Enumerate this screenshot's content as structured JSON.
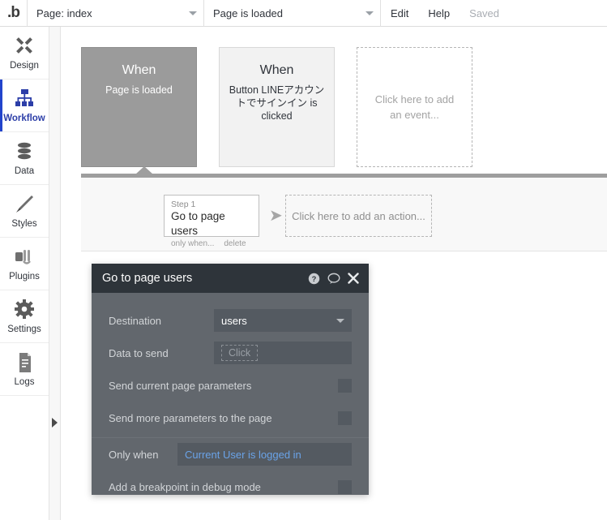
{
  "topbar": {
    "logo": ".b",
    "page_select": {
      "label": "Page: index",
      "icon": "chevron-down-icon"
    },
    "event_select": {
      "label": "Page is loaded",
      "icon": "chevron-down-icon"
    },
    "edit": "Edit",
    "help": "Help",
    "saved": "Saved"
  },
  "sidebar": {
    "items": [
      {
        "label": "Design",
        "icon": "design-icon",
        "active": false
      },
      {
        "label": "Workflow",
        "icon": "workflow-icon",
        "active": true
      },
      {
        "label": "Data",
        "icon": "data-icon",
        "active": false
      },
      {
        "label": "Styles",
        "icon": "styles-icon",
        "active": false
      },
      {
        "label": "Plugins",
        "icon": "plugins-icon",
        "active": false
      },
      {
        "label": "Settings",
        "icon": "gear-icon",
        "active": false
      },
      {
        "label": "Logs",
        "icon": "logs-icon",
        "active": false
      }
    ],
    "expander_icon": "right-triangle-icon"
  },
  "canvas": {
    "events": [
      {
        "when": "When",
        "desc": "Page is loaded",
        "state": "selected"
      },
      {
        "when": "When",
        "desc": "Button LINEアカウントでサインイン is clicked",
        "state": "plain"
      },
      {
        "add_label": "Click here to add an event...",
        "state": "add"
      }
    ],
    "actions": {
      "step": {
        "number": "Step 1",
        "title": "Go to page users",
        "only_when": "only when...",
        "delete": "delete"
      },
      "arrow_icon": "arrow-right-icon",
      "add_label": "Click here to add an action..."
    }
  },
  "modal": {
    "title": "Go to page users",
    "icons": [
      "help-circle-icon",
      "comment-icon",
      "close-icon"
    ],
    "fields": {
      "destination_label": "Destination",
      "destination_value": "users",
      "data_to_send_label": "Data to send",
      "data_to_send_value": "Click",
      "send_current_page_parameters_label": "Send current page parameters",
      "send_more_parameters_label": "Send more parameters to the page",
      "only_when_label": "Only when",
      "only_when_value": "Current User is logged in",
      "breakpoint_label": "Add a breakpoint in debug mode"
    }
  },
  "colors": {
    "accent": "#2244cc",
    "modal_header": "#2e343a",
    "modal_body": "#62676d",
    "expression_blue": "#6aa3e8",
    "selected_event": "#9b9b9b"
  }
}
